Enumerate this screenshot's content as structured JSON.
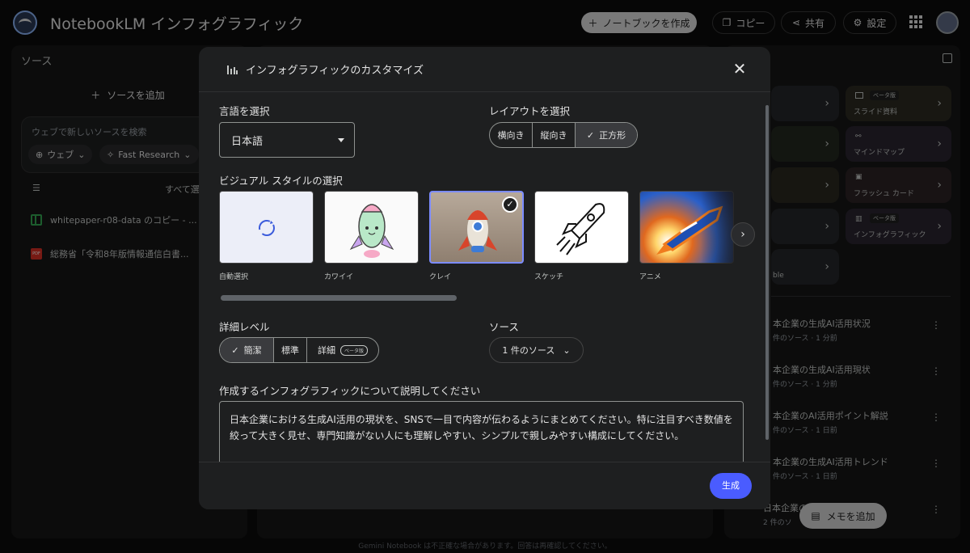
{
  "app": {
    "title": "NotebookLM インフォグラフィック"
  },
  "topbar": {
    "create_label": "ノートブックを作成",
    "copy_label": "コピー",
    "share_label": "共有",
    "settings_label": "設定"
  },
  "sources": {
    "title": "ソース",
    "add_label": "ソースを追加",
    "search_placeholder": "ウェブで新しいソースを検索",
    "web_chip": "ウェブ",
    "research_chip": "Fast Research",
    "select_all": "すべて選",
    "items": [
      {
        "label": "whitepaper-r08-data のコピー - ..."
      },
      {
        "label": "総務省「令和8年版情報通信白書..."
      }
    ]
  },
  "studio": {
    "slide_badge": "ベータ版",
    "slide_label": "スライド資料",
    "mindmap_label": "マインドマップ",
    "flashcard_label": "フラッシュ カード",
    "info_badge": "ベータ版",
    "info_label": "インフォグラフィック",
    "table_partial": "ble",
    "notes": [
      {
        "title": "本企業の生成AI活用状況",
        "sub": "件のソース · 1 分前"
      },
      {
        "title": "本企業の生成AI活用現状",
        "sub": "件のソース · 1 分前"
      },
      {
        "title": "本企業のAI活用ポイント解説",
        "sub": "件のソース · 1 日前"
      },
      {
        "title": "本企業の生成AI活用トレンド",
        "sub": "件のソース · 1 日前"
      },
      {
        "title": "日本企業の",
        "sub": "2 件のソ"
      }
    ],
    "memo_label": "メモを追加"
  },
  "dialog": {
    "title": "インフォグラフィックのカスタマイズ",
    "lang_label": "言語を選択",
    "lang_value": "日本語",
    "layout_label": "レイアウトを選択",
    "layout_options": [
      "横向き",
      "縦向き",
      "正方形"
    ],
    "layout_selected": "正方形",
    "style_label": "ビジュアル スタイルの選択",
    "styles": [
      "自動選択",
      "カワイイ",
      "クレイ",
      "スケッチ",
      "アニメ"
    ],
    "style_selected": "クレイ",
    "detail_label": "詳細レベル",
    "detail_options": [
      "簡潔",
      "標準",
      "詳細"
    ],
    "detail_badge": "ベータ版",
    "detail_selected": "簡潔",
    "source_label": "ソース",
    "source_value": "1 件のソース",
    "desc_label": "作成するインフォグラフィックについて説明してください",
    "desc_text": "日本企業における生成AI活用の現状を、SNSで一目で内容が伝わるようにまとめてください。特に注目すべき数値を絞って大きく見せ、専門知識がない人にも理解しやすい、シンプルで親しみやすい構成にしてください。",
    "generate_label": "生成"
  },
  "footer": {
    "text": "Gemini Notebook は不正確な場合があります。回答は再確認してください。"
  },
  "colors": {
    "accent": "#4a5cff",
    "selected_border": "#7c8cff"
  }
}
